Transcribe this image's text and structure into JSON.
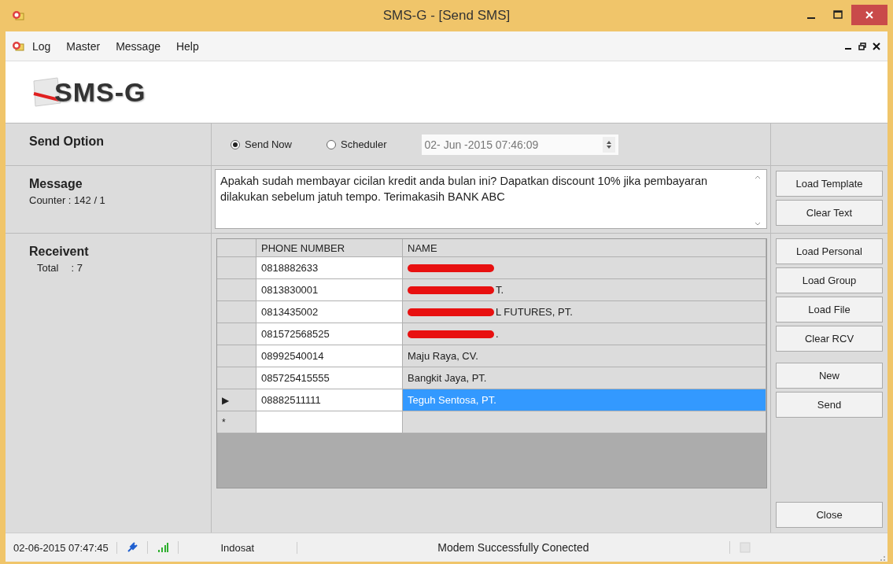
{
  "window": {
    "title": "SMS-G - [Send SMS]"
  },
  "menu": [
    "Log",
    "Master",
    "Message",
    "Help"
  ],
  "logo": {
    "text": "SMS-G"
  },
  "send_option": {
    "label": "Send Option",
    "options": [
      {
        "label": "Send Now",
        "selected": true
      },
      {
        "label": "Scheduler",
        "selected": false
      }
    ],
    "schedule_value": "02- Jun -2015 07:46:09"
  },
  "message": {
    "label": "Message",
    "counter": "Counter : 142 / 1",
    "text": "Apakah sudah membayar cicilan kredit anda bulan ini? Dapatkan discount 10% jika pembayaran dilakukan sebelum jatuh tempo. Terimakasih BANK ABC"
  },
  "receivent": {
    "label": "Receivent",
    "total_label": "Total",
    "total_value": ": 7"
  },
  "table": {
    "columns": [
      "PHONE NUMBER",
      "NAME"
    ],
    "rows": [
      {
        "phone": "0818882633",
        "redacted": true,
        "selected": false
      },
      {
        "phone": "0813830001",
        "name": "T.",
        "redacted": true,
        "selected": false
      },
      {
        "phone": "0813435002",
        "name": "L FUTURES, PT.",
        "redacted": true,
        "selected": false
      },
      {
        "phone": "081572568525",
        "name": ".",
        "redacted": true,
        "selected": false
      },
      {
        "phone": "08992540014",
        "name": "Maju Raya, CV.",
        "redacted": false,
        "selected": false
      },
      {
        "phone": "085725415555",
        "name": "Bangkit Jaya, PT.",
        "redacted": false,
        "selected": false
      },
      {
        "phone": "08882511111",
        "name": "Teguh Sentosa, PT.",
        "redacted": false,
        "selected": true
      }
    ],
    "new_row_marker": "*",
    "current_marker": "▶"
  },
  "message_buttons": [
    "Load Template",
    "Clear Text"
  ],
  "receiver_buttons": [
    "Load Personal",
    "Load Group",
    "Load File",
    "Clear RCV"
  ],
  "action_buttons": [
    "New",
    "Send"
  ],
  "close_button": "Close",
  "status_bar": {
    "datetime": "02-06-2015  07:47:45",
    "operator": "Indosat",
    "status": "Modem Successfully Conected"
  }
}
